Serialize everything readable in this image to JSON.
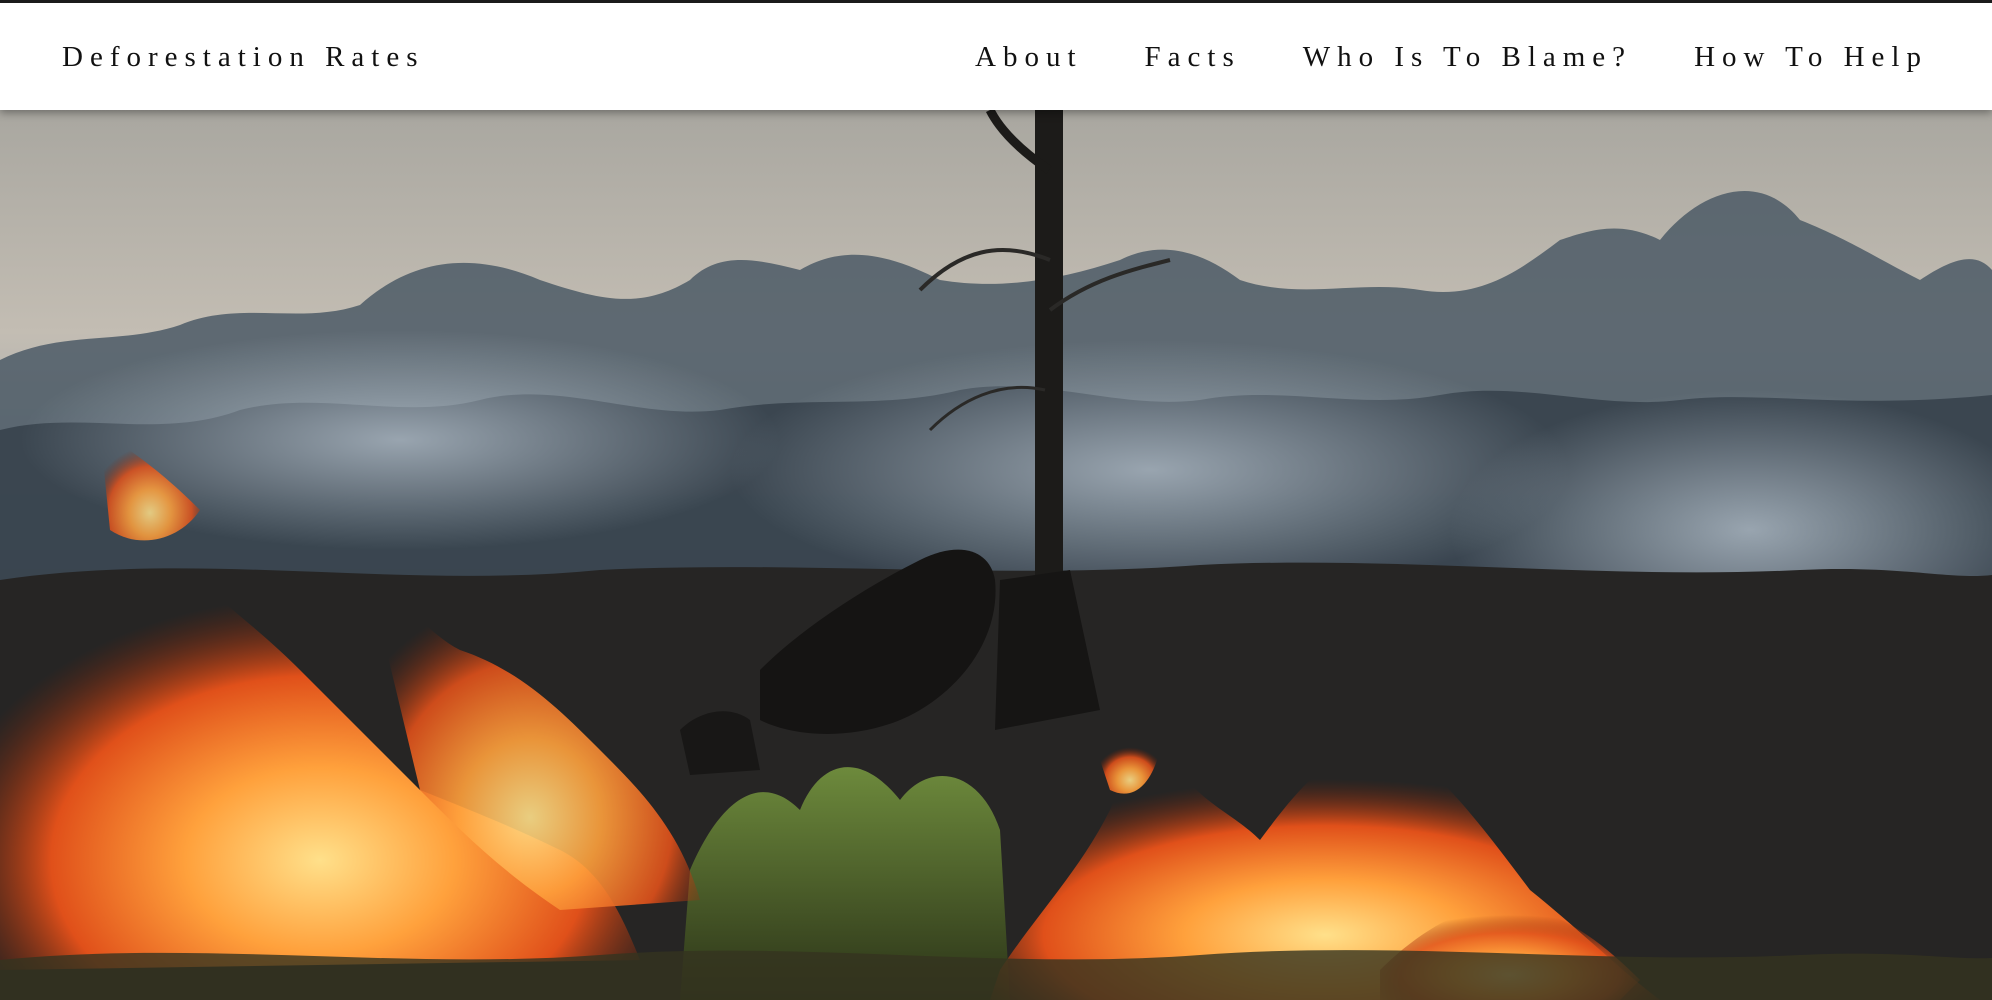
{
  "navbar": {
    "brand": "Deforestation Rates",
    "links": [
      {
        "label": "About"
      },
      {
        "label": "Facts"
      },
      {
        "label": "Who Is To Blame?"
      },
      {
        "label": "How To Help"
      }
    ]
  },
  "hero": {
    "image_icon": "burning-forest-photo-icon"
  },
  "colors": {
    "nav_bg": "#ffffff",
    "nav_text": "#111111",
    "sky": "#b9b8b2",
    "smoke": "#7d8a95",
    "ground": "#1f1f1f",
    "flame_core": "#ffb347",
    "flame_outer": "#e2521a"
  }
}
